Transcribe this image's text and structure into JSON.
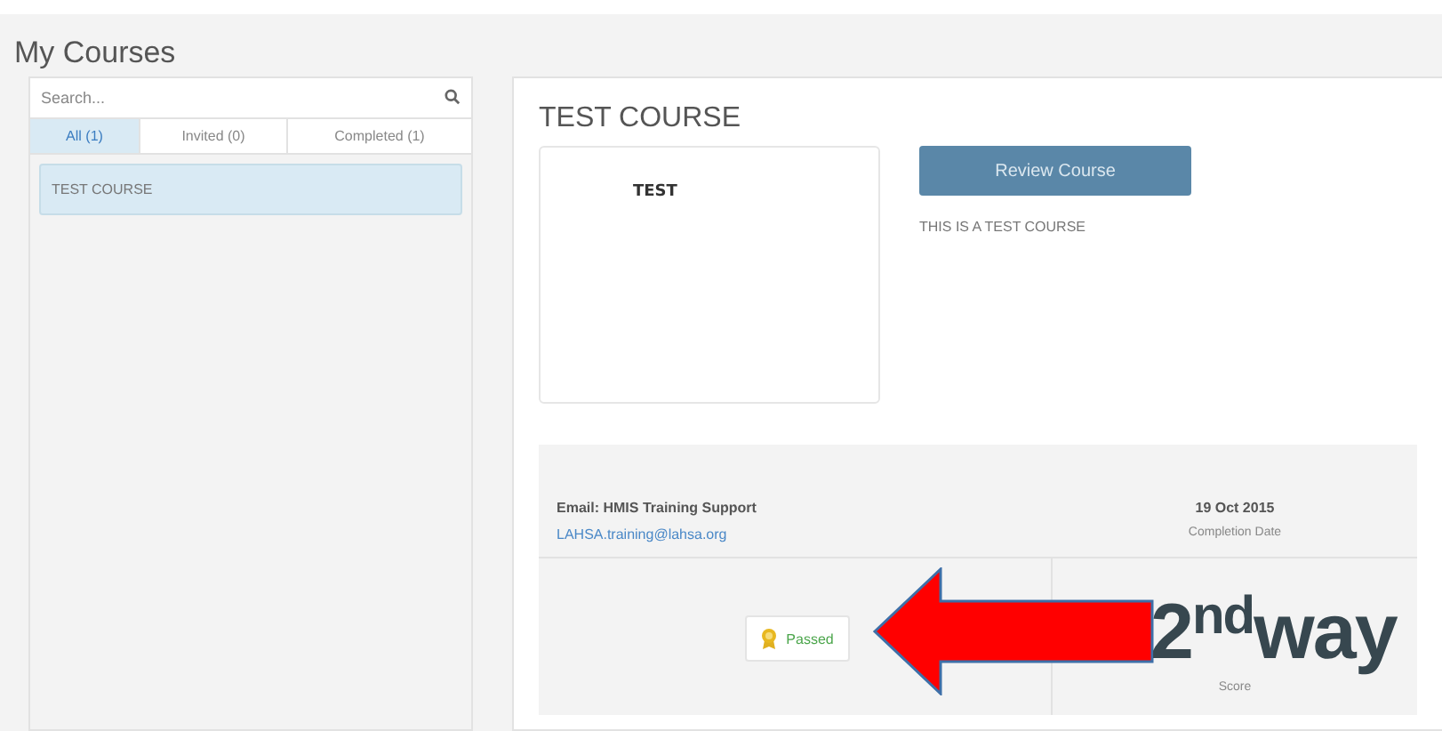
{
  "page_title": "My Courses",
  "search": {
    "placeholder": "Search..."
  },
  "tabs": [
    {
      "label": "All (1)",
      "selected": true
    },
    {
      "label": "Invited (0)",
      "selected": false
    },
    {
      "label": "Completed (1)",
      "selected": false
    }
  ],
  "courses": [
    {
      "name": "TEST COURSE",
      "selected": true
    }
  ],
  "detail": {
    "title": "TEST COURSE",
    "thumbnail_text": "TEST",
    "button": "Review Course",
    "description": "THIS IS A TEST COURSE",
    "contact_label": "Email: HMIS Training Support",
    "contact_email": "LAHSA.training@lahsa.org",
    "completion_date": "19 Oct 2015",
    "completion_label": "Completion Date",
    "status": "Passed",
    "score_label": "Score"
  },
  "annotation": {
    "text": "2$^{nd}$way"
  }
}
